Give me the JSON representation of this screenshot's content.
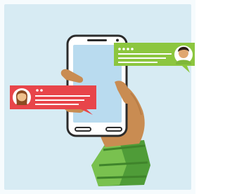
{
  "colors": {
    "background": "#d7ebf3",
    "border": "#f6fbfd",
    "phone_body": "#ffffff",
    "phone_outline": "#2b2b2b",
    "phone_screen": "#b9dbef",
    "hand_skin": "#c98c52",
    "sleeve_green": "#4f9c38",
    "sleeve_green_light": "#79c14f",
    "bubble_green": "#8cc63f",
    "bubble_red": "#e8454a",
    "bubble_text_lines": "#ffffff"
  },
  "icons": {
    "man_avatar": "man-avatar-icon",
    "woman_avatar": "woman-avatar-icon"
  }
}
